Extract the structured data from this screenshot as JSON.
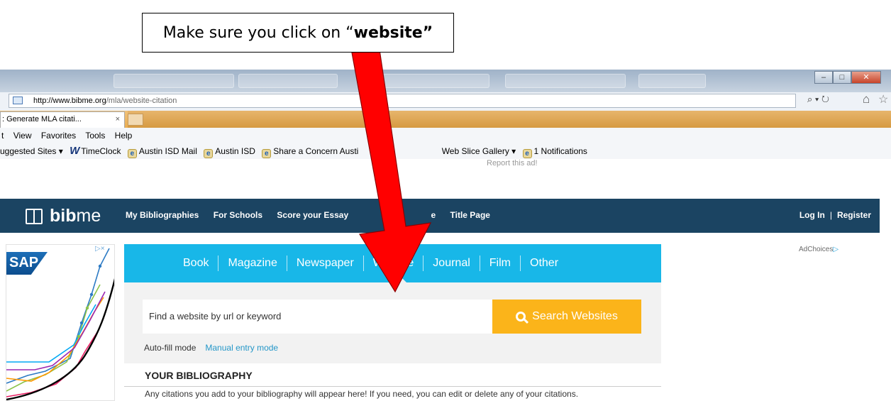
{
  "callout": {
    "prefix": "Make sure you click on “",
    "bold": "website”"
  },
  "browser": {
    "url_host": "http://www.bibme.org",
    "url_path": "/mla/website-citation",
    "active_tab": ": Generate MLA citati...",
    "tab_close": "×",
    "menu": [
      "t",
      "View",
      "Favorites",
      "Tools",
      "Help"
    ],
    "favorites": {
      "suggested": "uggested Sites ▾",
      "timeclock": "TimeClock",
      "austin_mail": "Austin ISD Mail",
      "austin": "Austin ISD",
      "share": "Share a Concern Austi",
      "web_slice": "Web Slice Gallery ▾",
      "notifications": "1 Notifications"
    },
    "search_glyph": "⌕ ▾ ↻",
    "home_glyph": "⌂",
    "star_glyph": "☆",
    "report_ad": "Report this ad!"
  },
  "site": {
    "logo_bold": "bib",
    "logo_light": "me",
    "nav": [
      "My Bibliographies",
      "For Schools",
      "Score your Essay",
      "",
      "e",
      "Title Page"
    ],
    "login": "Log In",
    "sep": "|",
    "register": "Register",
    "types": [
      "Book",
      "Magazine",
      "Newspaper",
      "Website",
      "Journal",
      "Film",
      "Other"
    ],
    "search_placeholder": "Find a website by url or keyword",
    "search_button": "Search Websites",
    "mode_auto": "Auto-fill mode",
    "mode_manual": "Manual entry mode",
    "bib_title": "YOUR BIBLIOGRAPHY",
    "bib_text": "Any citations you add to your bibliography will appear here! If you need, you can edit or delete any of your citations.",
    "adchoices": "AdChoices",
    "ad_logo": "SAP",
    "ad_controls": "▷×"
  },
  "colors": {
    "navbar": "#1b4462",
    "type_bar": "#18b7e8",
    "search_button": "#fbb41a",
    "arrow": "#ff0000"
  }
}
